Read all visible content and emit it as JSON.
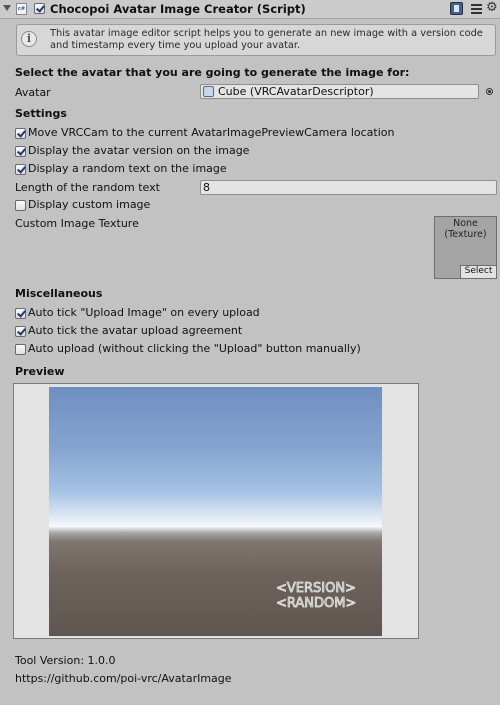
{
  "header": {
    "title": "Chocopoi Avatar Image Creator (Script)",
    "enabled": true,
    "script_icon_text": "c#",
    "icons": [
      "foldout-arrow-icon",
      "script-icon",
      "book-help-icon",
      "preset-icon",
      "gear-icon"
    ]
  },
  "helpbox": {
    "text": "This avatar image editor script helps you to generate an new image with a version code and timestamp every time you upload your avatar."
  },
  "select_heading": "Select the avatar that you are going to generate the image for:",
  "avatar": {
    "label": "Avatar",
    "value": "Cube (VRCAvatarDescriptor)"
  },
  "settings": {
    "heading": "Settings",
    "move_cam": {
      "label": "Move VRCCam to the current AvatarImagePreviewCamera location",
      "checked": true
    },
    "display_version": {
      "label": "Display the avatar version on the image",
      "checked": true
    },
    "display_random": {
      "label": "Display a random text on the image",
      "checked": true
    },
    "random_length": {
      "label": "Length of the random text",
      "value": "8"
    },
    "display_custom": {
      "label": "Display custom image",
      "checked": false
    },
    "custom_texture": {
      "label": "Custom Image Texture",
      "slot_text": "None\n(Texture)",
      "select_label": "Select"
    }
  },
  "misc": {
    "heading": "Miscellaneous",
    "auto_tick_upload": {
      "label": "Auto tick \"Upload Image\" on every upload",
      "checked": true
    },
    "auto_tick_agreement": {
      "label": "Auto tick the avatar upload agreement",
      "checked": true
    },
    "auto_upload": {
      "label": "Auto upload (without clicking the \"Upload\" button manually)",
      "checked": false
    }
  },
  "preview": {
    "heading": "Preview",
    "watermark_version": "<VERSION>",
    "watermark_random": "<RANDOM>"
  },
  "footer": {
    "tool_version": "Tool Version: 1.0.0",
    "url": "https://github.com/poi-vrc/AvatarImage"
  },
  "colors": {
    "background": "#c2c2c2",
    "check": "#1c3a6e",
    "sky_top": "#6f8fc2",
    "ground": "#6d635c"
  }
}
